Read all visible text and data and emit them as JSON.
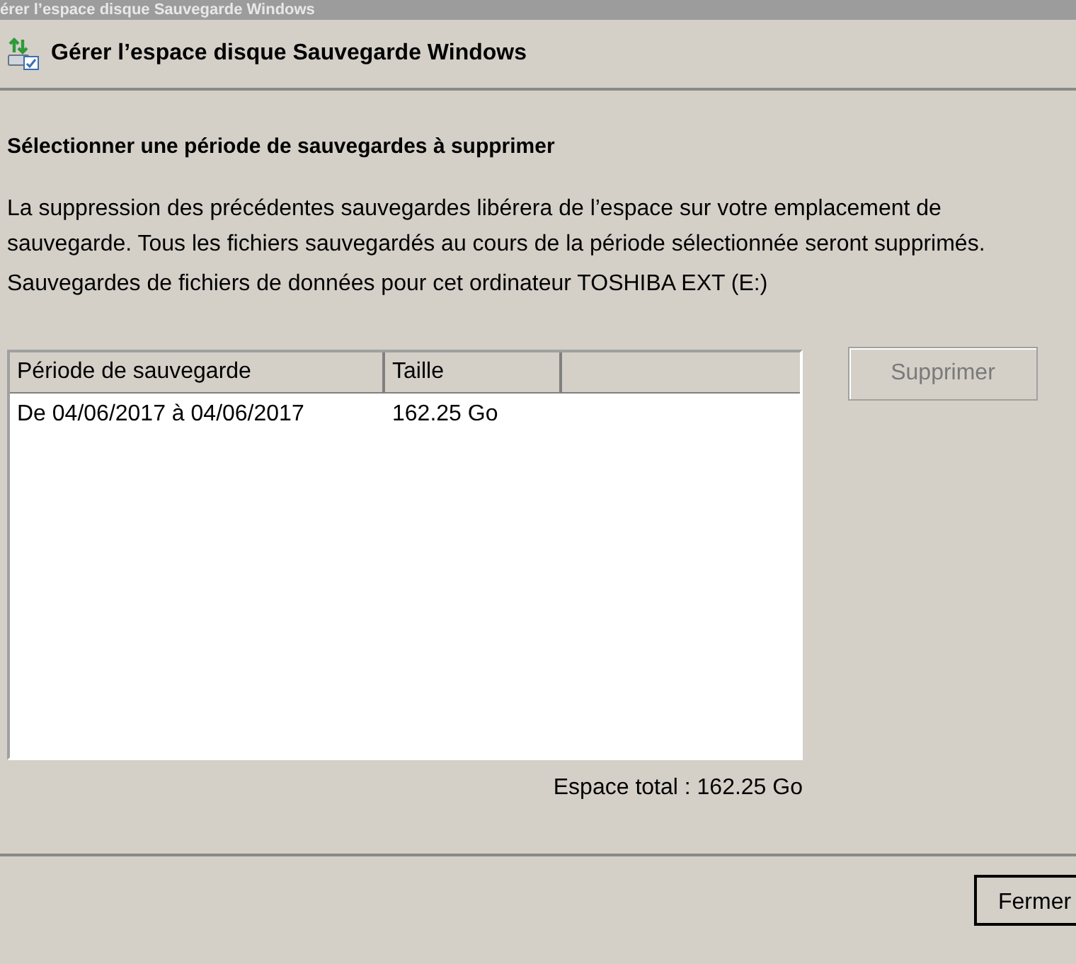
{
  "window": {
    "title": "érer l’espace disque Sauvegarde Windows"
  },
  "header": {
    "title": "Gérer l’espace disque Sauvegarde Windows"
  },
  "section": {
    "heading": "Sélectionner une période de sauvegardes à supprimer",
    "description": "La suppression des précédentes sauvegardes libérera de l’espace sur votre emplacement de sauvegarde. Tous les fichiers sauvegardés au cours de la période sélectionnée seront supprimés.",
    "source": "Sauvegardes de fichiers de données pour cet ordinateur TOSHIBA EXT (E:)"
  },
  "table": {
    "columns": [
      "Période de sauvegarde",
      "Taille"
    ],
    "rows": [
      {
        "cells": [
          "De 04/06/2017 à 04/06/2017",
          "162.25 Go"
        ],
        "selected": false
      }
    ]
  },
  "delete_button": {
    "label": "Supprimer",
    "disabled": true
  },
  "total": "Espace total : 162.25 Go",
  "close_button": {
    "label": "Fermer",
    "disabled": false
  }
}
